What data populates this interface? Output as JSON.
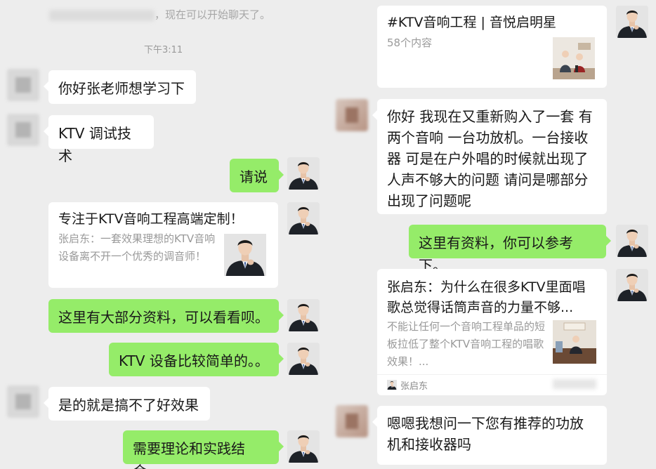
{
  "left": {
    "system_notice": "，现在可以开始聊天了。",
    "timestamp": "下午3:11",
    "messages": [
      {
        "text": "你好张老师想学习下"
      },
      {
        "text": "KTV 调试技术"
      },
      {
        "text": "请说"
      },
      {
        "card_title": "专注于KTV音响工程高端定制！",
        "card_desc": "张启东：一套效果理想的KTV音响设备离不开一个优秀的调音师！"
      },
      {
        "text": "这里有大部分资料，可以看看呗。"
      },
      {
        "text": "KTV 设备比较简单的。。"
      },
      {
        "text": "是的就是搞不了好效果"
      },
      {
        "text": "需要理论和实践结合。"
      }
    ]
  },
  "right": {
    "topic_card": {
      "title": "#KTV音响工程 | 音悦启明星",
      "count": "58个内容"
    },
    "messages": [
      {
        "text": "你好 我现在又重新购入了一套 有两个音响 一台功放机。一台接收器 可是在户外唱的时候就出现了人声不够大的问题 请问是哪部分出现了问题呢"
      },
      {
        "text": "这里有资料，你可以参考下。"
      },
      {
        "card_title": "张启东：为什么在很多KTV里面唱歌总觉得话筒声音的力量不够...",
        "card_desc": "不能让任何一个音响工程单品的短板拉低了整个KTV音响工程的唱歌效果！...",
        "author": "张启东"
      },
      {
        "text": "嗯嗯我想问一下您有推荐的功放机和接收器吗"
      }
    ]
  },
  "colors": {
    "background": "#ededed",
    "sent_bubble": "#95ec69",
    "received_bubble": "#ffffff"
  }
}
